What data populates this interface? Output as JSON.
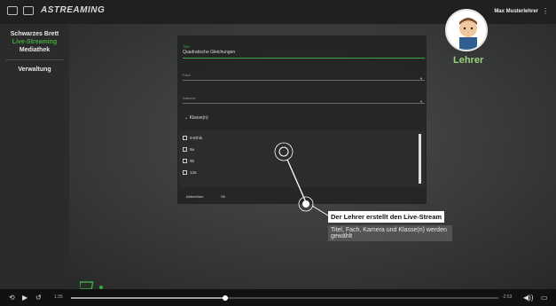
{
  "header": {
    "app_title": "ASTREAMING",
    "user_name": "Max Musterlehrer"
  },
  "sidebar": {
    "items": [
      {
        "label": "Schwarzes Brett",
        "active": false
      },
      {
        "label": "Live-Streaming",
        "active": true
      },
      {
        "label": "Mediathek",
        "active": false
      },
      {
        "label": "Verwaltung",
        "active": false
      }
    ]
  },
  "form": {
    "title_field": {
      "label": "Titel",
      "value": "Quadratische Gleichungen"
    },
    "subject_field": {
      "label": "Fach",
      "value": ""
    },
    "camera_field": {
      "label": "Kamera",
      "value": ""
    },
    "classes_header": "Klasse(n)",
    "classes": [
      "9-Ethik",
      "9a",
      "9b",
      "12a"
    ],
    "cancel_label": "Abbrechen",
    "ok_label": "Ok"
  },
  "presenter": {
    "label": "Lehrer"
  },
  "caption": {
    "title": "Der Lehrer erstellt den Live-Stream",
    "body": "Titel, Fach, Kamera und Klasse(n) werden gewählt"
  },
  "player": {
    "elapsed": "1:35",
    "remaining": "-2:53",
    "progress_fraction": 0.36
  },
  "colors": {
    "accent": "#3ea93e",
    "background": "#393b3b"
  }
}
